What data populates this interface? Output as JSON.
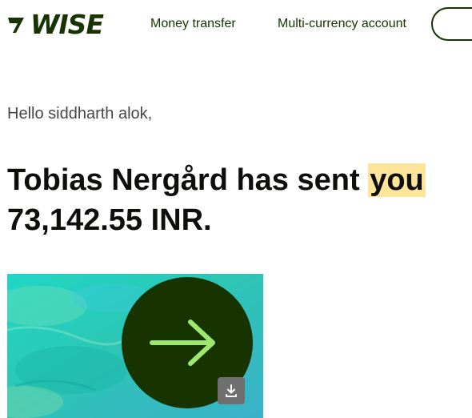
{
  "header": {
    "logo_text": "WISE",
    "nav": {
      "money_transfer": "Money transfer",
      "multi_currency": "Multi-currency account"
    }
  },
  "main": {
    "greeting": "Hello siddharth alok,",
    "headline": {
      "part1": "Tobias Nergård has sent ",
      "highlight": "you",
      "part2": "73,142.55 INR."
    }
  },
  "icons": {
    "logo": "wise-flag-icon",
    "hero": "arrow-right-icon",
    "download": "download-icon"
  },
  "colors": {
    "brand_green": "#163300",
    "accent_lime": "#9fe870",
    "highlight": "#ffe59a"
  }
}
